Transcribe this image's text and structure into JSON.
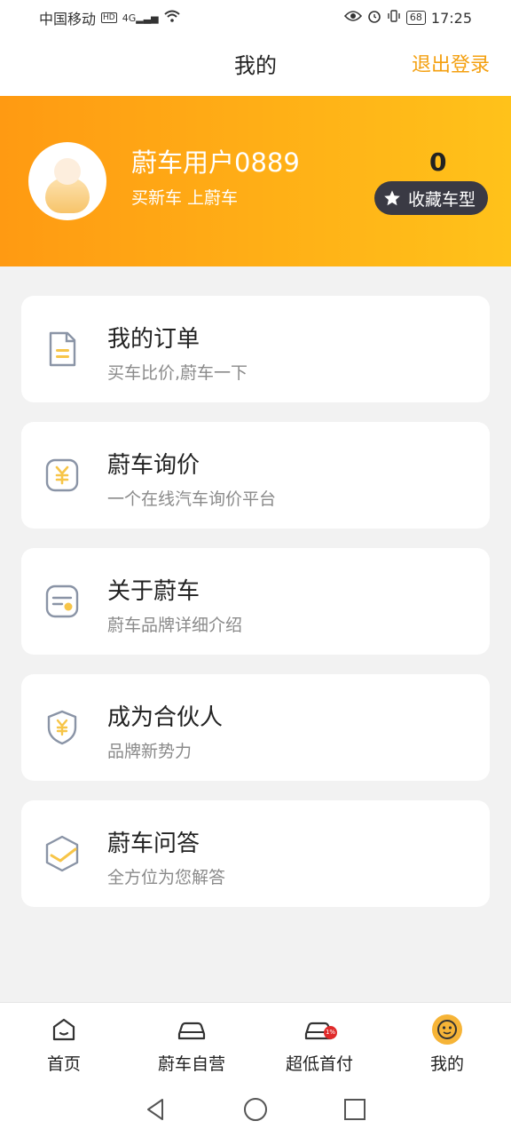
{
  "status_bar": {
    "carrier": "中国移动",
    "hd": "HD",
    "network": "4G",
    "battery": "68",
    "time": "17:25"
  },
  "header": {
    "title": "我的",
    "logout": "退出登录"
  },
  "profile": {
    "username": "蔚车用户0889",
    "tagline": "买新车 上蔚车",
    "favorites_count": "0",
    "favorites_label": "收藏车型"
  },
  "menu": [
    {
      "title": "我的订单",
      "subtitle": "买车比价,蔚车一下",
      "icon": "document-icon"
    },
    {
      "title": "蔚车询价",
      "subtitle": "一个在线汽车询价平台",
      "icon": "yuan-icon"
    },
    {
      "title": "关于蔚车",
      "subtitle": "蔚车品牌详细介绍",
      "icon": "card-icon"
    },
    {
      "title": "成为合伙人",
      "subtitle": "品牌新势力",
      "icon": "shield-yuan-icon"
    },
    {
      "title": "蔚车问答",
      "subtitle": "全方位为您解答",
      "icon": "hexagon-check-icon"
    }
  ],
  "tabbar": [
    {
      "label": "首页",
      "icon": "home-icon"
    },
    {
      "label": "蔚车自营",
      "icon": "car-icon"
    },
    {
      "label": "超低首付",
      "icon": "car-discount-icon",
      "badge": "1%"
    },
    {
      "label": "我的",
      "icon": "smiley-icon",
      "active": true
    }
  ],
  "colors": {
    "accent": "#f4a010",
    "banner_start": "#ff9a12",
    "banner_end": "#ffc21a",
    "icon_gray": "#8a94a6",
    "icon_yellow": "#f7c548"
  }
}
